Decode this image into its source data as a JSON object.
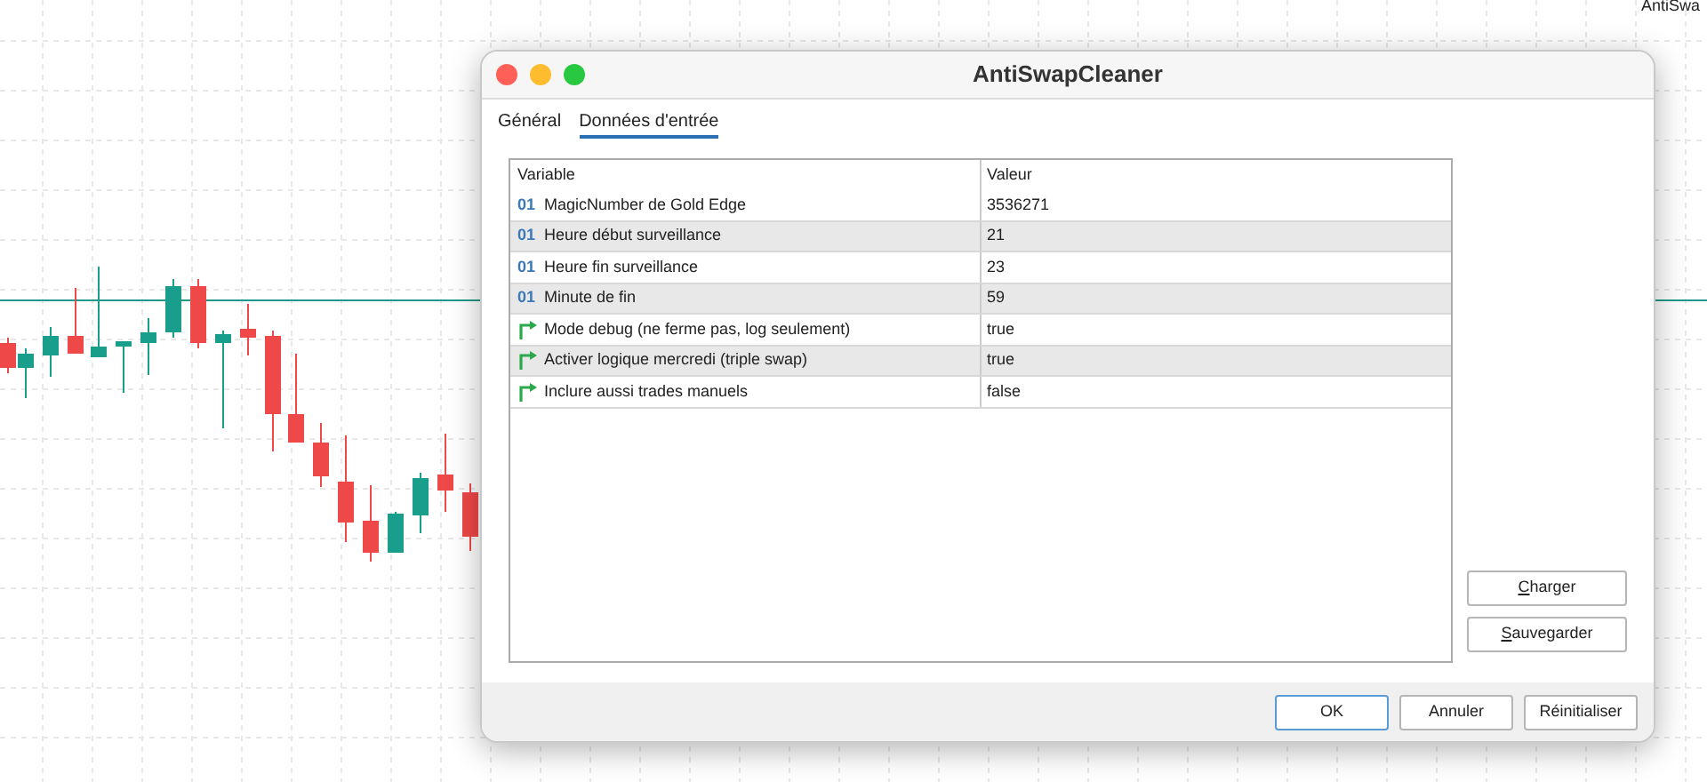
{
  "chart_corner_label": "AntiSwa",
  "window": {
    "title": "AntiSwapCleaner"
  },
  "tabs": [
    {
      "label": "Général",
      "selected": false
    },
    {
      "label": "Données d'entrée",
      "selected": true
    }
  ],
  "table": {
    "columns": [
      "Variable",
      "Valeur"
    ],
    "rows": [
      {
        "kind": "integer",
        "icon_text": "01",
        "variable": "MagicNumber de Gold Edge",
        "value": "3536271"
      },
      {
        "kind": "integer",
        "icon_text": "01",
        "variable": "Heure début surveillance",
        "value": "21"
      },
      {
        "kind": "integer",
        "icon_text": "01",
        "variable": "Heure fin surveillance",
        "value": "23"
      },
      {
        "kind": "integer",
        "icon_text": "01",
        "variable": "Minute de fin",
        "value": "59"
      },
      {
        "kind": "boolean",
        "variable": "Mode debug (ne ferme pas, log seulement)",
        "value": "true"
      },
      {
        "kind": "boolean",
        "variable": "Activer logique mercredi (triple swap)",
        "value": "true"
      },
      {
        "kind": "boolean",
        "variable": "Inclure aussi trades manuels",
        "value": "false"
      }
    ]
  },
  "side_buttons": [
    {
      "label": "Charger"
    },
    {
      "label": "Sauvegarder"
    }
  ],
  "footer_buttons": [
    {
      "label": "OK",
      "default": true
    },
    {
      "label": "Annuler",
      "default": false
    },
    {
      "label": "Réinitialiser",
      "default": false
    }
  ]
}
